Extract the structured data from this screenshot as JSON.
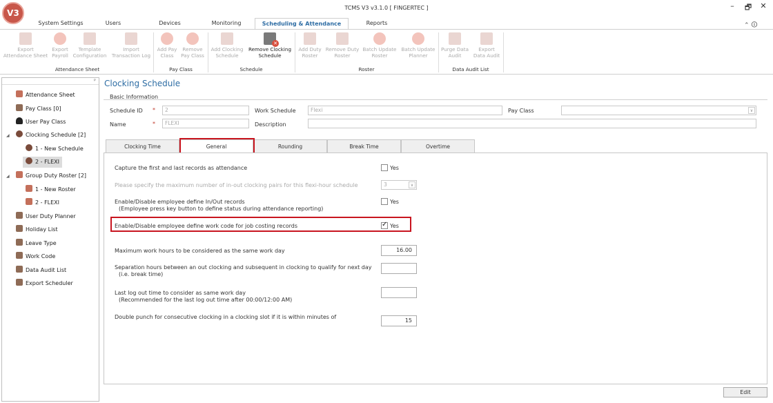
{
  "window": {
    "title": "TCMS V3 v3.1.0 [ FINGERTEC ]",
    "logo_text": "V3",
    "minimize": "–",
    "restore": "🗗",
    "close": "✕",
    "help_icons": "⌃ 🛈"
  },
  "ribbon_tabs": [
    "System Settings",
    "Users",
    "Devices",
    "Monitoring",
    "Scheduling & Attendance",
    "Reports"
  ],
  "ribbon": {
    "buttons": [
      {
        "label": "Export\nAttendance Sheet"
      },
      {
        "label": "Export\nPayroll"
      },
      {
        "label": "Template\nConfiguration"
      },
      {
        "label": "Import\nTransaction Log"
      },
      {
        "label": "Add Pay\nClass"
      },
      {
        "label": "Remove\nPay Class"
      },
      {
        "label": "Add Clocking\nSchedule"
      },
      {
        "label": "Remove Clocking\nSchedule"
      },
      {
        "label": "Add Duty\nRoster"
      },
      {
        "label": "Remove Duty\nRoster"
      },
      {
        "label": "Batch Update\nRoster"
      },
      {
        "label": "Batch Update\nPlanner"
      },
      {
        "label": "Purge Data\nAudit"
      },
      {
        "label": "Export\nData Audit"
      }
    ],
    "groups": [
      "Attendance Sheet",
      "Pay Class",
      "Schedule",
      "Roster",
      "Data Audit List"
    ]
  },
  "nav": {
    "items": [
      "Attendance Sheet",
      "Pay Class [0]",
      "User Pay Class",
      "Clocking Schedule [2]",
      "1 - New Schedule",
      "2 - FLEXI",
      "Group Duty Roster [2]",
      "1 - New Roster",
      "2 - FLEXI",
      "User Duty Planner",
      "Holiday List",
      "Leave Type",
      "Work Code",
      "Data Audit List",
      "Export Scheduler"
    ]
  },
  "main": {
    "title": "Clocking Schedule",
    "basic_info": "Basic Information",
    "fields": {
      "schedule_id_label": "Schedule ID",
      "schedule_id_value": "2",
      "name_label": "Name",
      "name_value": "FLEXI",
      "work_schedule_label": "Work Schedule",
      "work_schedule_value": "Flexi",
      "description_label": "Description",
      "description_value": "",
      "pay_class_label": "Pay Class",
      "pay_class_value": "",
      "required_mark": "*"
    },
    "subtabs": [
      "Clocking Time",
      "General",
      "Rounding",
      "Break Time",
      "Overtime"
    ],
    "general": {
      "opt1": "Capture the first and last records as attendance",
      "opt2": "Please specify the maximum number of in-out clocking pairs for this flexi-hour schedule",
      "opt2_value": "3",
      "opt3a": "Enable/Disable employee define In/Out records",
      "opt3b": "(Employee press key button to define status during attendance reporting)",
      "opt4": "Enable/Disable employee define work code for job costing records",
      "opt5": "Maximum work hours to be considered as the same work day",
      "opt5_value": "16.00",
      "opt6a": "Separation hours between an out clocking and subsequent in clocking to qualify for next day",
      "opt6b": "(i.e. break time)",
      "opt7a": "Last log out time to consider as same work day",
      "opt7b": "(Recommended for the last log out time after 00:00/12:00 AM)",
      "opt8": "Double punch for consecutive clocking in a clocking slot if it is within minutes of",
      "opt8_value": "15",
      "yes": "Yes",
      "capture_first_last_checked": false,
      "define_inout_checked": false,
      "define_workcode_checked": true
    },
    "edit_button": "Edit"
  }
}
